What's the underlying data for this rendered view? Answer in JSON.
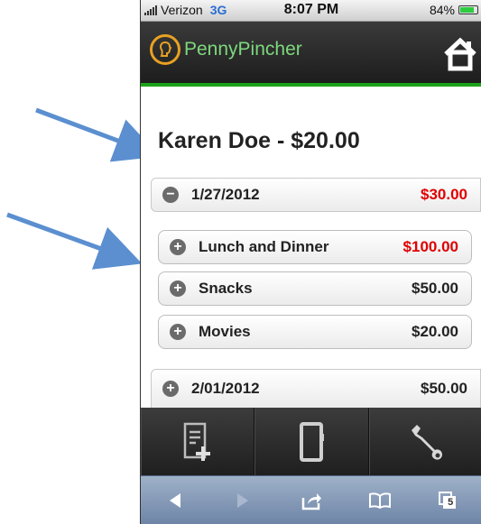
{
  "status": {
    "carrier": "Verizon",
    "network": "3G",
    "time": "8:07 PM",
    "battery": "84%"
  },
  "app": {
    "name": "PennyPincher",
    "colors": {
      "accent_green": "#1aa31a",
      "logo_orange": "#e8a123",
      "amount_red": "#e00000"
    }
  },
  "page": {
    "title": "Karen Doe - $20.00"
  },
  "days": [
    {
      "date": "1/27/2012",
      "amount": "$30.00",
      "expanded": true,
      "items": [
        {
          "label": "Lunch and Dinner",
          "amount": "$100.00"
        },
        {
          "label": "Snacks",
          "amount": "$50.00"
        },
        {
          "label": "Movies",
          "amount": "$20.00"
        }
      ]
    },
    {
      "date": "2/01/2012",
      "amount": "$50.00",
      "expanded": false
    }
  ],
  "tabbar": {
    "icons": [
      "new-receipt-icon",
      "notebook-icon",
      "wrench-icon"
    ]
  },
  "browser_toolbar": {
    "tabs_count": "5"
  }
}
